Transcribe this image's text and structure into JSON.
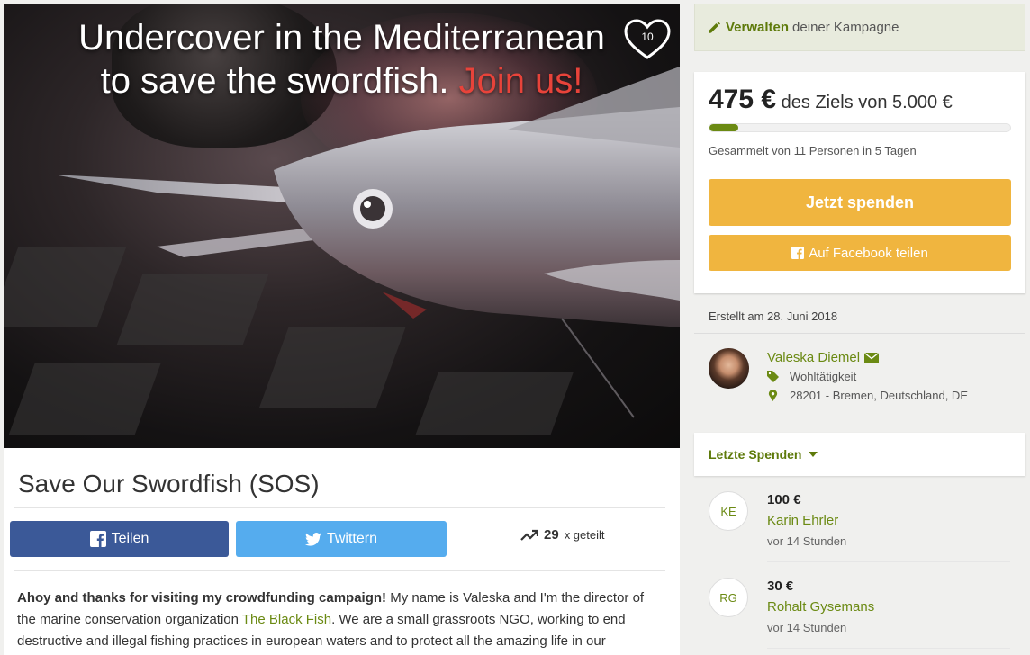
{
  "hero": {
    "title_line1": "Undercover in the Mediterranean",
    "title_line2": "to save the swordfish.",
    "title_join": "Join us!",
    "like_count": "10",
    "like_icon": "heart-icon"
  },
  "campaign": {
    "title": "Save Our Swordfish (SOS)",
    "share_facebook": "Teilen",
    "share_twitter": "Twittern",
    "share_count": "29",
    "share_count_suffix": "x geteilt",
    "intro_bold": "Ahoy and thanks for visiting my crowdfunding campaign!",
    "intro_text": " My name is Valeska and I'm the director of the marine conservation organization ",
    "intro_link": "The Black Fish",
    "intro_rest": ". We are a small grassroots NGO, working to end destructive and illegal fishing practices in european waters and to protect all the amazing life in our"
  },
  "sidebar": {
    "manage_bold": "Verwalten",
    "manage_text": "deiner Kampagne",
    "amount": "475 €",
    "goal_text": "des Ziels von 5.000 €",
    "progress_fraction": 0.095,
    "raised_text": "Gesammelt von 11 Personen in 5 Tagen",
    "donate_button": "Jetzt spenden",
    "fb_share_button": "Auf Facebook teilen",
    "created": "Erstellt am 28. Juni 2018",
    "owner_name": "Valeska Diemel",
    "category": "Wohltätigkeit",
    "location": "28201 - Bremen, Deutschland, DE",
    "last_donations_label": "Letzte Spenden",
    "donations": [
      {
        "initials": "KE",
        "amount": "100 €",
        "name": "Karin Ehrler",
        "time": "vor 14 Stunden"
      },
      {
        "initials": "RG",
        "amount": "30 €",
        "name": "Rohalt Gysemans",
        "time": "vor 14 Stunden"
      }
    ]
  },
  "colors": {
    "accent_green": "#6b8a13",
    "donate_yellow": "#f0b53f",
    "facebook_blue": "#3b5998",
    "twitter_blue": "#55acee",
    "hero_red": "#e8433a"
  }
}
